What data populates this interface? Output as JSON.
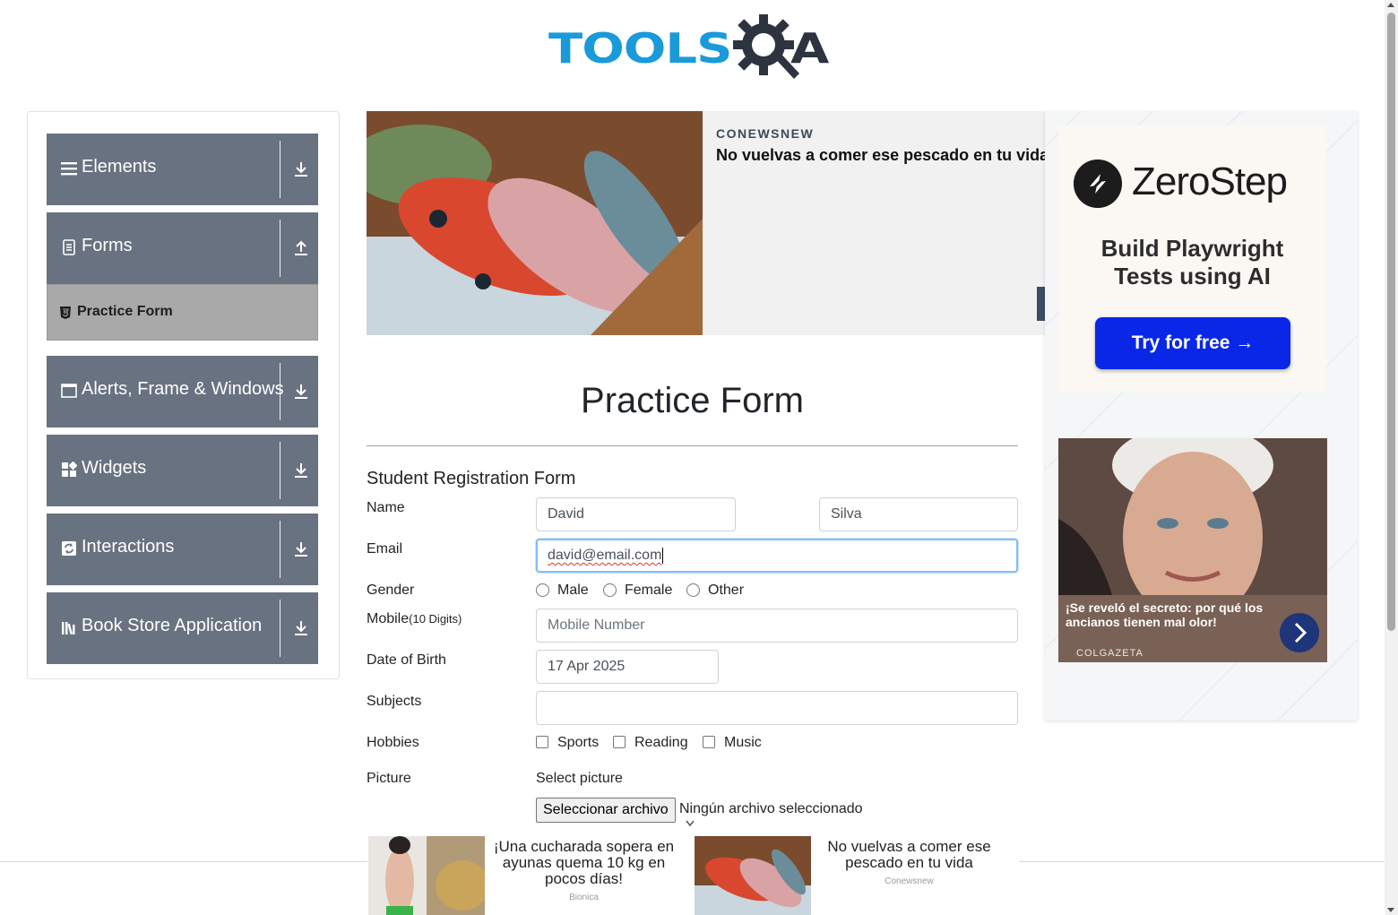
{
  "header": {
    "logo_text": "TOOLS",
    "logo_text_end": "A"
  },
  "colors": {
    "sidebar_group": "#687280",
    "sidebar_active": "#a9a9a9",
    "logo_blue": "#1a9ad9",
    "focus_border": "#80bdff",
    "cta_blue": "#0a27e8"
  },
  "sidebar": {
    "groups": [
      {
        "label": "Elements",
        "icon": "hamburger-icon",
        "arrow": "download-arrow-icon"
      },
      {
        "label": "Forms",
        "icon": "document-icon",
        "arrow": "upload-arrow-icon"
      },
      {
        "label": "Alerts, Frame & Windows",
        "icon": "window-icon",
        "arrow": "download-arrow-icon"
      },
      {
        "label": "Widgets",
        "icon": "widgets-icon",
        "arrow": "download-arrow-icon"
      },
      {
        "label": "Interactions",
        "icon": "interactions-icon",
        "arrow": "download-arrow-icon"
      },
      {
        "label": "Book Store Application",
        "icon": "books-icon",
        "arrow": "download-arrow-icon"
      }
    ],
    "active_item": {
      "label": "Practice Form",
      "icon": "html5-icon"
    }
  },
  "top_ad": {
    "brand": "CONEWSNEW",
    "headline": "No vuelvas a comer ese pescado en tu vida"
  },
  "right_ad": {
    "zerostep": {
      "name": "ZeroStep",
      "tagline_1": "Build Playwright",
      "tagline_2": "Tests using AI",
      "cta": "Try for free →"
    },
    "story": {
      "caption": "¡Se reveló el secreto: por qué los ancianos tienen mal olor!",
      "source": "COLGAZETA"
    }
  },
  "form": {
    "page_title": "Practice Form",
    "subtitle": "Student Registration Form",
    "name_label": "Name",
    "first_name": "David",
    "last_name": "Silva",
    "email_label": "Email",
    "email": "david@email.com",
    "gender_label": "Gender",
    "gender_options": [
      "Male",
      "Female",
      "Other"
    ],
    "mobile_label": "Mobile",
    "mobile_hint": "(10 Digits)",
    "mobile_placeholder": "Mobile Number",
    "dob_label": "Date of Birth",
    "dob": "17 Apr 2025",
    "subjects_label": "Subjects",
    "subjects_value": "",
    "hobbies_label": "Hobbies",
    "hobby_options": [
      "Sports",
      "Reading",
      "Music"
    ],
    "picture_label": "Picture",
    "select_picture": "Select picture",
    "file_button": "Seleccionar archivo",
    "file_status": "Ningún archivo seleccionado"
  },
  "bottom_ad": [
    {
      "headline": "¡Una cucharada sopera en ayunas quema 10 kg en pocos días!",
      "source": "Bionica"
    },
    {
      "headline": "No vuelvas a comer ese pescado en tu vida",
      "source": "Conewsnew"
    }
  ]
}
